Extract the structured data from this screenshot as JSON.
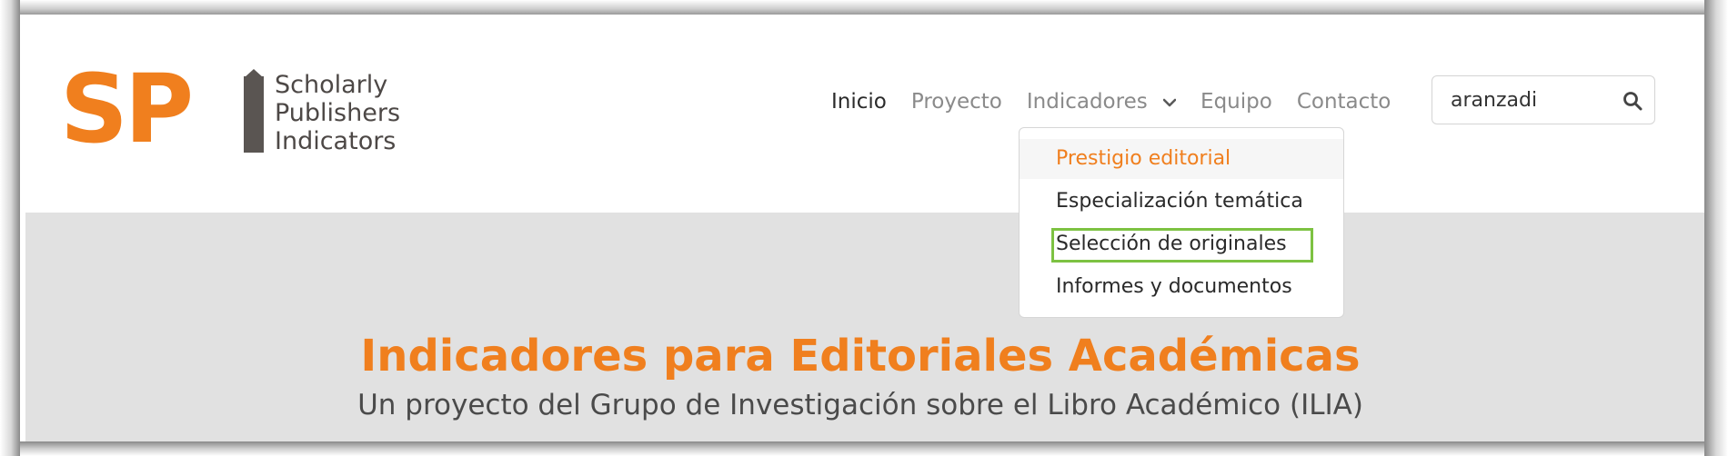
{
  "logo": {
    "mark": "SP",
    "lines": [
      "Scholarly",
      "Publishers",
      "Indicators"
    ]
  },
  "nav": {
    "items": [
      {
        "label": "Inicio",
        "active": true
      },
      {
        "label": "Proyecto",
        "active": false
      },
      {
        "label": "Indicadores",
        "active": false,
        "has_dropdown": true
      },
      {
        "label": "Equipo",
        "active": false
      },
      {
        "label": "Contacto",
        "active": false
      }
    ]
  },
  "search": {
    "value": "aranzadi",
    "icon": "search-icon"
  },
  "dropdown": {
    "items": [
      {
        "label": "Prestigio editorial",
        "hovered": true
      },
      {
        "label": "Especialización temática",
        "hovered": false
      },
      {
        "label": "Selección de originales",
        "highlighted": true
      },
      {
        "label": "Informes y documentos",
        "hovered": false
      }
    ],
    "highlight_color": "#7dc242"
  },
  "hero": {
    "title": "Indicadores para Editoriales Académicas",
    "subtitle": "Un proyecto del Grupo de Investigación sobre el Libro Académico (ILIA)"
  },
  "colors": {
    "brand_orange": "#f07f1e",
    "logo_gray": "#5a5552",
    "hero_bg": "#e1e1e1"
  }
}
